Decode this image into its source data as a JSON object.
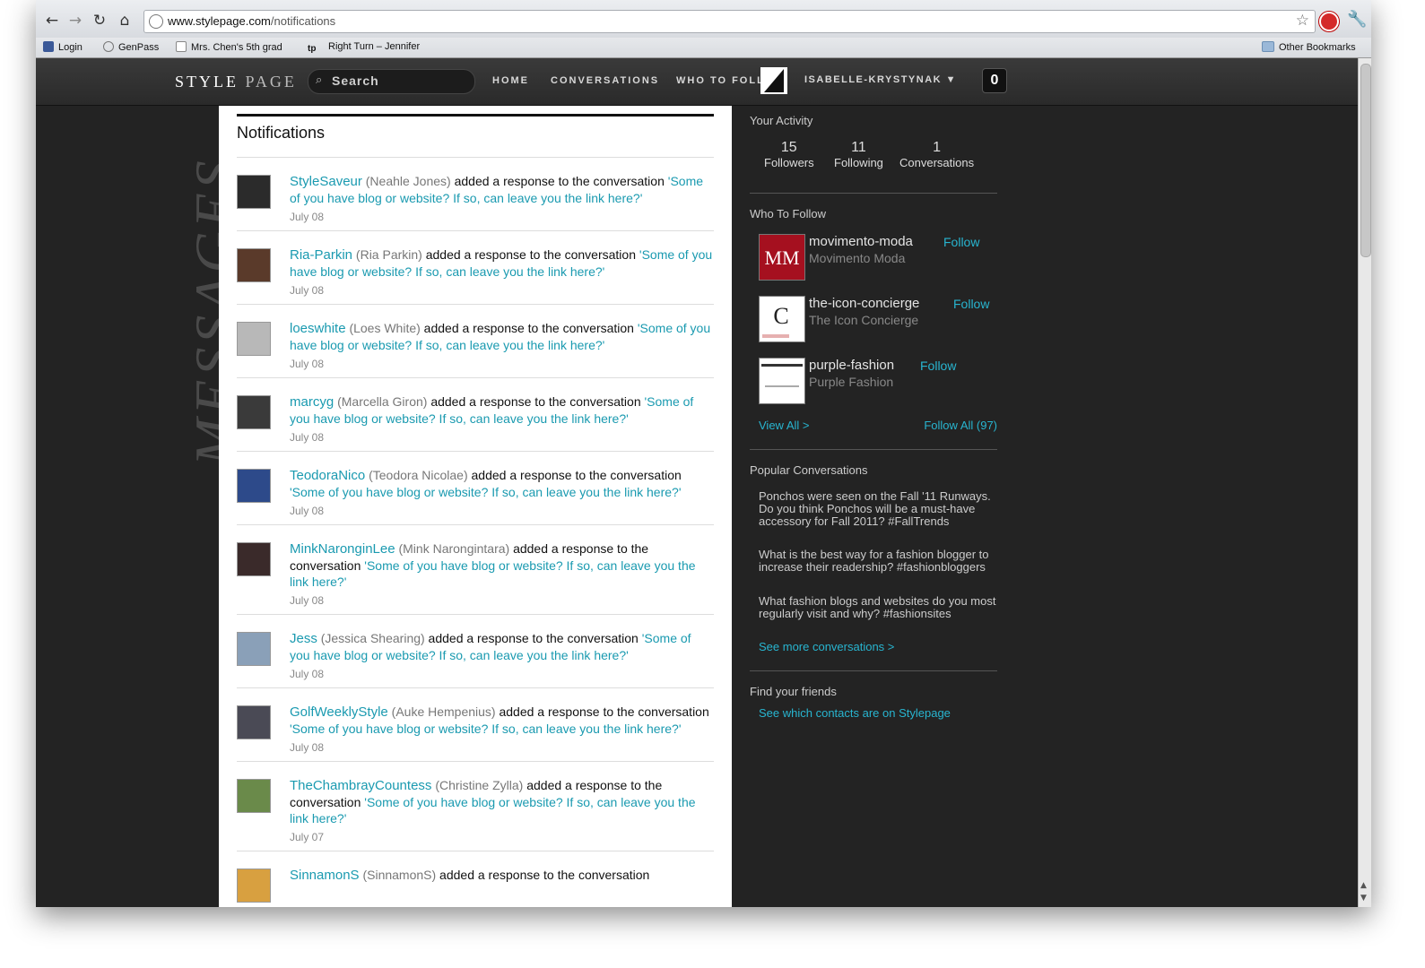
{
  "browser": {
    "url_host": "www.stylepage.com",
    "url_path": "/notifications",
    "bookmarks": [
      "Login",
      "GenPass",
      "Mrs. Chen's 5th grad",
      "Right Turn – Jennifer"
    ],
    "other_bookmarks": "Other Bookmarks"
  },
  "site": {
    "logo_style": "STYLE",
    "logo_page": "PAGE",
    "search_placeholder": "Search",
    "nav": [
      "HOME",
      "CONVERSATIONS",
      "WHO TO FOLL"
    ],
    "user": "ISABELLE-KRYSTYNAK ▼",
    "notification_count": "0",
    "watermark": "MESSAGES"
  },
  "main": {
    "title": "Notifications",
    "notifications": [
      {
        "user": "StyleSaveur",
        "real": "(Neahle Jones)",
        "action": " added a response to the conversation ",
        "conv": "'Some of you have blog or website? If so, can leave you the link here?'",
        "date": "July 08"
      },
      {
        "user": "Ria-Parkin",
        "real": "(Ria Parkin)",
        "action": " added a response to the conversation ",
        "conv": "'Some of you have blog or website? If so, can leave you the link here?'",
        "date": "July 08"
      },
      {
        "user": "loeswhite",
        "real": "(Loes White)",
        "action": " added a response to the conversation ",
        "conv": "'Some of you have blog or website? If so, can leave you the link here?'",
        "date": "July 08"
      },
      {
        "user": "marcyg",
        "real": "(Marcella Giron)",
        "action": " added a response to the conversation ",
        "conv": "'Some of you have blog or website? If so, can leave you the link here?'",
        "date": "July 08"
      },
      {
        "user": "TeodoraNico",
        "real": "(Teodora Nicolae)",
        "action": " added a response to the conversation ",
        "conv": "'Some of you have blog or website? If so, can leave you the link here?'",
        "date": "July 08"
      },
      {
        "user": "MinkNaronginLee",
        "real": "(Mink Narongintara)",
        "action": " added a response to the conversation ",
        "conv": "'Some of you have blog or website? If so, can leave you the link here?'",
        "date": "July 08"
      },
      {
        "user": "Jess",
        "real": "(Jessica Shearing)",
        "action": " added a response to the conversation ",
        "conv": "'Some of you have blog or website? If so, can leave you the link here?'",
        "date": "July 08"
      },
      {
        "user": "GolfWeeklyStyle",
        "real": "(Auke Hempenius)",
        "action": " added a response to the conversation ",
        "conv": "'Some of you have blog or website? If so, can leave you the link here?'",
        "date": "July 08"
      },
      {
        "user": "TheChambrayCountess",
        "real": "(Christine Zylla)",
        "action": " added a response to the conversation ",
        "conv": "'Some of you have blog or website? If so, can leave you the link here?'",
        "date": "July 07"
      },
      {
        "user": "SinnamonS",
        "real": "(SinnamonS)",
        "action": " added a response to the conversation",
        "conv": "",
        "date": ""
      }
    ]
  },
  "sidebar": {
    "activity_title": "Your Activity",
    "stats": [
      {
        "num": "15",
        "label": "Followers"
      },
      {
        "num": "11",
        "label": "Following"
      },
      {
        "num": "1",
        "label": "Conversations"
      }
    ],
    "wtf_title": "Who To Follow",
    "who_to_follow": [
      {
        "username": "movimento-moda",
        "name": "Movimento Moda",
        "follow": "Follow"
      },
      {
        "username": "the-icon-concierge",
        "name": "The Icon Concierge",
        "follow": "Follow"
      },
      {
        "username": "purple-fashion",
        "name": "Purple Fashion",
        "follow": "Follow"
      }
    ],
    "view_all": "View All >",
    "follow_all": "Follow All (97)",
    "popular_title": "Popular Conversations",
    "popular": [
      "Ponchos were seen on the Fall '11 Runways. Do you think Ponchos will be a must-have accessory for Fall 2011? #FallTrends",
      "What is the best way for a fashion blogger to increase their readership? #fashionbloggers",
      "What fashion blogs and websites do you most regularly visit and why? #fashionsites"
    ],
    "see_more": "See more conversations >",
    "friends_title": "Find your friends",
    "friends_link": "See which contacts are on Stylepage"
  }
}
